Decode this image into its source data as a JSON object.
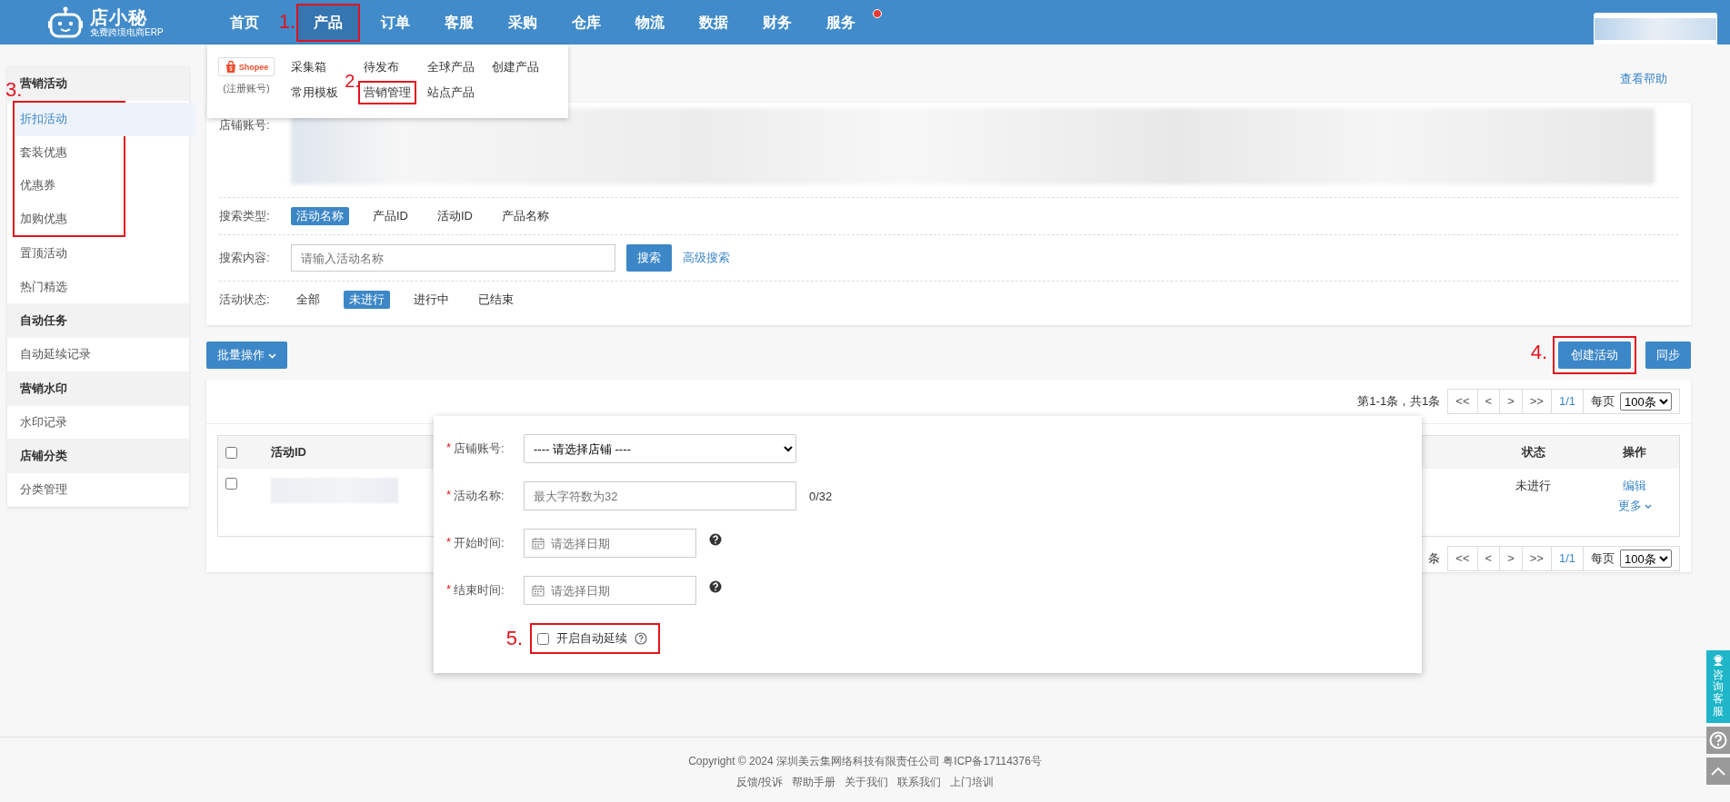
{
  "header": {
    "logo": {
      "name": "店小秘",
      "tagline": "免费跨境电商ERP"
    },
    "nav": [
      {
        "label": "首页",
        "selected": false
      },
      {
        "label": "产品",
        "selected": true,
        "annotation": "1."
      },
      {
        "label": "订单",
        "selected": false
      },
      {
        "label": "客服",
        "selected": false
      },
      {
        "label": "采购",
        "selected": false
      },
      {
        "label": "仓库",
        "selected": false
      },
      {
        "label": "物流",
        "selected": false
      },
      {
        "label": "数据",
        "selected": false
      },
      {
        "label": "财务",
        "selected": false
      },
      {
        "label": "服务",
        "selected": false,
        "dot": true
      }
    ]
  },
  "product_menu": {
    "platform": {
      "name": "Shopee",
      "note": "(注册账号)"
    },
    "links": [
      {
        "label": "采集箱"
      },
      {
        "label": "待发布"
      },
      {
        "label": "全球产品"
      },
      {
        "label": "创建产品"
      },
      {
        "label": "常用模板"
      },
      {
        "label": "营销管理",
        "annotation": "2."
      },
      {
        "label": "站点产品"
      }
    ]
  },
  "sidebar": {
    "sections": [
      {
        "title": "营销活动",
        "highlight_label": "3.",
        "items": [
          {
            "label": "折扣活动",
            "selected": true,
            "highlighted": true
          },
          {
            "label": "套装优惠",
            "selected": false,
            "highlighted": true
          },
          {
            "label": "优惠券",
            "selected": false,
            "highlighted": true
          },
          {
            "label": "加购优惠",
            "selected": false,
            "highlighted": true
          },
          {
            "label": "置顶活动",
            "selected": false,
            "highlighted": false
          },
          {
            "label": "热门精选",
            "selected": false,
            "highlighted": false
          }
        ]
      },
      {
        "title": "自动任务",
        "items": [
          {
            "label": "自动延续记录",
            "selected": false,
            "highlighted": false
          }
        ]
      },
      {
        "title": "营销水印",
        "items": [
          {
            "label": "水印记录",
            "selected": false,
            "highlighted": false
          }
        ]
      },
      {
        "title": "店铺分类",
        "items": [
          {
            "label": "分类管理",
            "selected": false,
            "highlighted": false
          }
        ]
      }
    ]
  },
  "help_link": "查看帮助",
  "filters": {
    "account_label": "店铺账号:",
    "search_type": {
      "label": "搜索类型:",
      "options": [
        {
          "label": "活动名称",
          "selected": true
        },
        {
          "label": "产品ID",
          "selected": false
        },
        {
          "label": "活动ID",
          "selected": false
        },
        {
          "label": "产品名称",
          "selected": false
        }
      ]
    },
    "search_content": {
      "label": "搜索内容:",
      "placeholder": "请输入活动名称",
      "button": "搜索",
      "advanced": "高级搜索"
    },
    "status": {
      "label": "活动状态:",
      "options": [
        {
          "label": "全部",
          "selected": false
        },
        {
          "label": "未进行",
          "selected": true
        },
        {
          "label": "进行中",
          "selected": false
        },
        {
          "label": "已结束",
          "selected": false
        }
      ]
    }
  },
  "toolbar": {
    "batch": "批量操作",
    "create": {
      "label": "创建活动",
      "annotation": "4."
    },
    "sync": "同步"
  },
  "pagination_top": {
    "summary": "第1-1条，共1条",
    "buttons": [
      "<<",
      "<",
      ">",
      ">>"
    ],
    "page": "1/1",
    "per_page_label": "每页",
    "per_page": "100条"
  },
  "table": {
    "header_checked": false,
    "columns": [
      {
        "label": "活动ID"
      },
      {
        "label": "状态"
      },
      {
        "label": "操作"
      }
    ],
    "rows": [
      {
        "checked": false,
        "status": "未进行",
        "actions": [
          "编辑",
          "更多"
        ]
      }
    ]
  },
  "pagination_bottom": {
    "summary": "条",
    "buttons": [
      "<<",
      "<",
      ">",
      ">>"
    ],
    "page": "1/1",
    "per_page_label": "每页",
    "per_page": "100条"
  },
  "modal": {
    "fields": [
      {
        "kind": "select",
        "mark": "*",
        "label": "店铺账号:",
        "value": "---- 请选择店铺 ----"
      },
      {
        "kind": "text",
        "mark": "*",
        "label": "活动名称:",
        "placeholder": "最大字符数为32",
        "counter": "0/32"
      },
      {
        "kind": "date",
        "mark": "*",
        "label": "开始时间:",
        "placeholder": "请选择日期",
        "help": true
      },
      {
        "kind": "date",
        "mark": "*",
        "label": "结束时间:",
        "placeholder": "请选择日期",
        "help": true
      }
    ],
    "auto_renew": {
      "label": "开启自动延续",
      "checked": false,
      "annotation": "5."
    }
  },
  "footer": {
    "copyright": "Copyright © 2024 深圳美云集网络科技有限责任公司  粤ICP备17114376号",
    "links": [
      "反馈/投诉",
      "帮助手册",
      "关于我们",
      "联系我们",
      "上门培训"
    ]
  },
  "side_widgets": {
    "consult": "咨询客服"
  }
}
